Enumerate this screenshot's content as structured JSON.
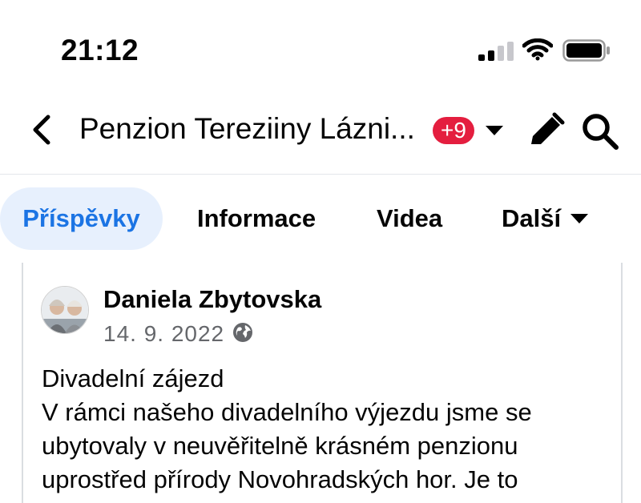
{
  "status_bar": {
    "time": "21:12",
    "signal_icon": "cellular-signal-icon",
    "wifi_icon": "wifi-icon",
    "battery_icon": "battery-icon"
  },
  "header": {
    "back_icon": "chevron-left-icon",
    "title": "Penzion Tereziiny Lázni...",
    "badge": "+9",
    "edit_icon": "pencil-icon",
    "search_icon": "search-icon"
  },
  "tabs": [
    {
      "label": "Příspěvky",
      "active": true
    },
    {
      "label": "Informace",
      "active": false
    },
    {
      "label": "Videa",
      "active": false
    },
    {
      "label": "Další",
      "active": false
    }
  ],
  "post": {
    "author": "Daniela Zbytovska",
    "date": "14. 9. 2022 ·",
    "audience_icon": "globe-icon",
    "lines": [
      "Divadelní zájezd",
      "V rámci našeho divadelního výjezdu jsme se",
      "ubytovaly v neuvěřitelně krásném penzionu",
      "uprostřed přírody Novohradských hor. Je to"
    ]
  },
  "colors": {
    "accent": "#1b74e4",
    "active_tab_bg": "#e7f0fd",
    "badge": "#e41e3f",
    "secondary_text": "#65676b"
  }
}
